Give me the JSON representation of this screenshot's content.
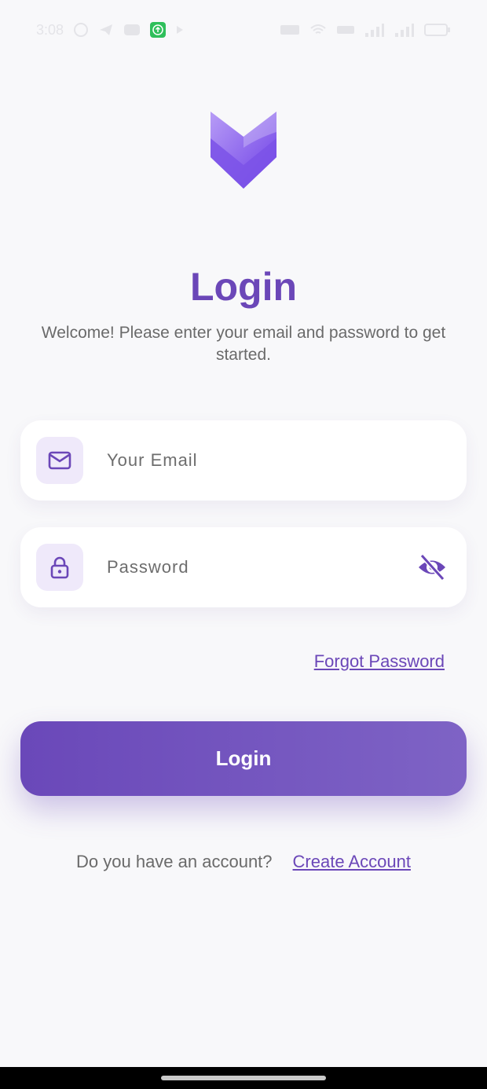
{
  "status_bar": {
    "time": "3:08",
    "left_icons": [
      "whatsapp-icon",
      "telegram-icon",
      "youtube-icon",
      "upload-icon",
      "play-icon"
    ],
    "right_icons": [
      "data-speed-icon",
      "wifi-icon",
      "volte-icon",
      "signal-icon",
      "signal-icon",
      "battery-icon"
    ]
  },
  "logo": {
    "icon": "chevron-v-logo-icon",
    "colors": {
      "light": "#b79cf6",
      "dark": "#6d3ee6"
    }
  },
  "title": "Login",
  "subtitle": "Welcome! Please enter your email and password to get started.",
  "email_field": {
    "placeholder": "Your Email",
    "value": "",
    "icon": "mail-icon"
  },
  "password_field": {
    "placeholder": "Password",
    "value": "",
    "icon": "lock-icon",
    "toggle_icon": "eye-off-icon"
  },
  "forgot_password": "Forgot Password",
  "login_button": "Login",
  "signup": {
    "prompt": "Do you have an account?",
    "link": "Create Account"
  },
  "colors": {
    "accent": "#6b47b8",
    "icon_bg": "#efe9fa",
    "background": "#f8f8fa",
    "field_bg": "#ffffff"
  }
}
